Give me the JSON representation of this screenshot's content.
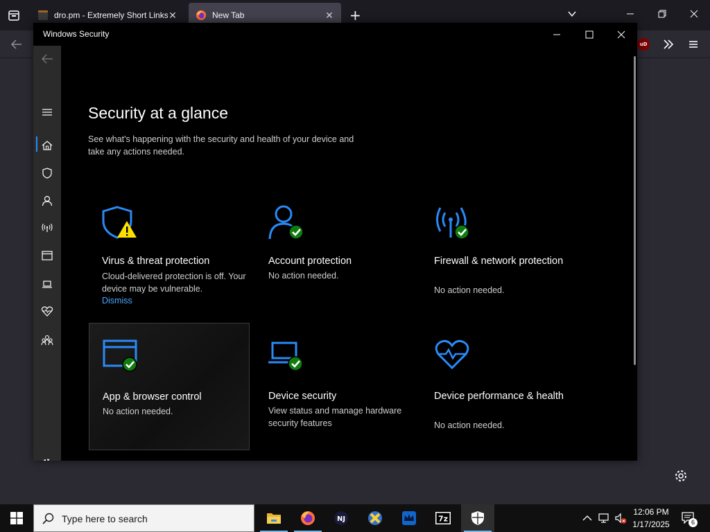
{
  "browser": {
    "tabs": [
      {
        "title": "dro.pm - Extremely Short Links",
        "active": false
      },
      {
        "title": "New Tab",
        "active": true
      }
    ],
    "new_tab_symbol": "+",
    "close_symbol": "✕",
    "ublock_label": "uD"
  },
  "window": {
    "title": "Windows Security"
  },
  "page": {
    "heading": "Security at a glance",
    "subtitle": "See what's happening with the security and health of your device and take any actions needed."
  },
  "tiles": [
    {
      "title": "Virus & threat protection",
      "desc": "Cloud-delivered protection is off. Your device may be vulnerable.",
      "link": "Dismiss",
      "status": "warning"
    },
    {
      "title": "Account protection",
      "desc": "No action needed.",
      "status": "ok"
    },
    {
      "title": "Firewall & network protection",
      "desc": "No action needed.",
      "status": "ok"
    },
    {
      "title": "App & browser control",
      "desc": "No action needed.",
      "status": "ok"
    },
    {
      "title": "Device security",
      "desc": "View status and manage hardware security features",
      "status": "ok"
    },
    {
      "title": "Device performance & health",
      "desc": "No action needed.",
      "status": "none"
    }
  ],
  "sidebar_icons": [
    "back-arrow-icon",
    "hamburger-icon",
    "home-icon",
    "shield-icon",
    "person-icon",
    "antenna-icon",
    "browser-window-icon",
    "laptop-icon",
    "heart-pulse-icon",
    "family-icon",
    "settings-gear-icon"
  ],
  "taskbar": {
    "search_placeholder": "Type here to search",
    "time": "12:06 PM",
    "date": "1/17/2025",
    "notification_count": "6",
    "apps": [
      "file-explorer-icon",
      "firefox-icon",
      "nj-app-icon",
      "x-app-icon",
      "crown-app-icon",
      "7zip-icon",
      "windows-security-icon"
    ],
    "7zip_label": "7z",
    "nj_label": "NJ"
  },
  "colors": {
    "accent": "#2a8af6",
    "ok": "#107c10",
    "warning": "#fce100",
    "link": "#4ea6ff",
    "window_bg": "#000000",
    "rail_bg": "#2b2b2b"
  }
}
